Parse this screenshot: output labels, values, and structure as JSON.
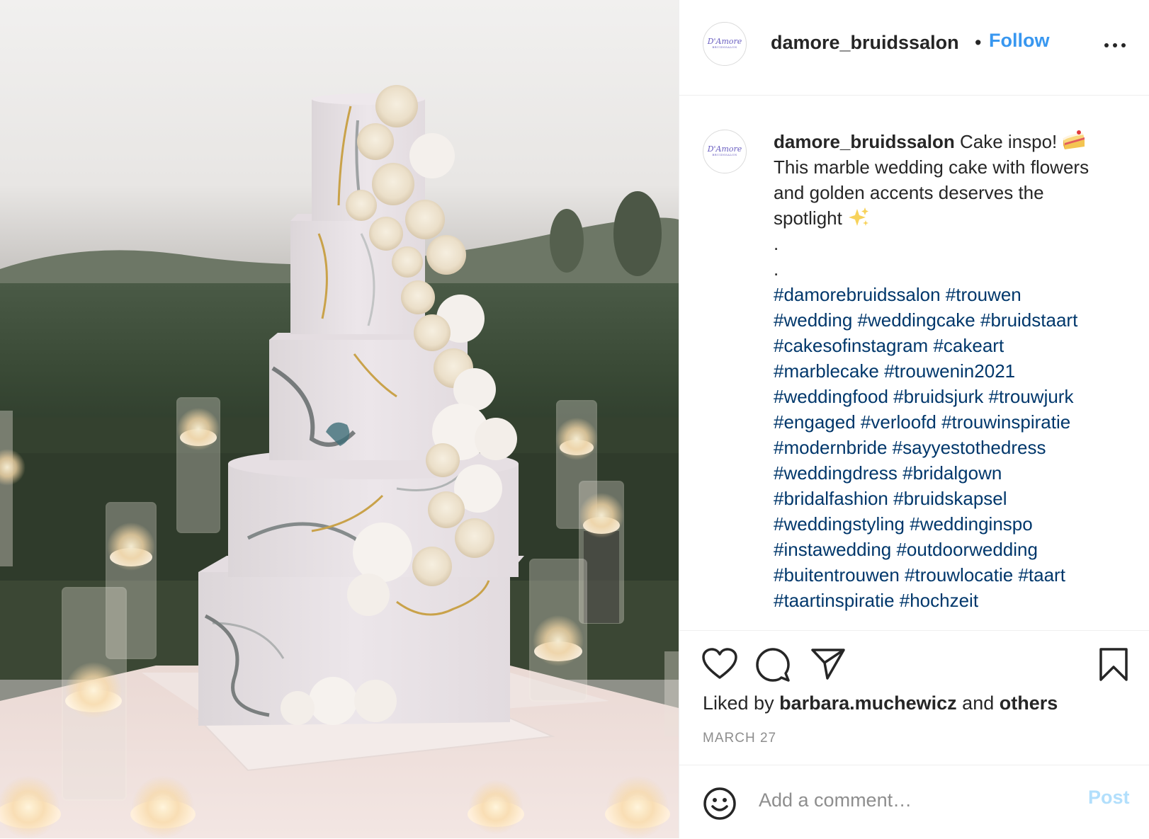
{
  "post": {
    "username": "damore_bruidssalon",
    "avatar_logo_text": "D'Amore",
    "avatar_logo_sub": "BRUIDSSALON",
    "follow_label": "Follow",
    "header_dot": "•",
    "more_icon": "more-options-icon",
    "caption": {
      "username": "damore_bruidssalon",
      "text_line1": " Cake inspo! ",
      "emoji1": "cake-slice-emoji",
      "text_line2": "This marble wedding cake with flowers",
      "text_line3": "and golden accents deserves the",
      "text_line4": "spotlight ",
      "emoji2": "sparkles-emoji",
      "dot1": ".",
      "dot2": ".",
      "hashtag_lines": [
        "#damorebruidssalon #trouwen",
        "#wedding #weddingcake #bruidstaart",
        "#cakesofinstagram #cakeart",
        "#marblecake #trouwenin2021",
        "#weddingfood #bruidsjurk #trouwjurk",
        "#engaged #verloofd #trouwinspiratie",
        "#modernbride #sayyestothedress",
        "#weddingdress #bridalgown",
        "#bridalfashion #bruidskapsel",
        "#weddingstyling #weddinginspo",
        "#instawedding #outdoorwedding",
        "#buitentrouwen #trouwlocatie #taart",
        "#taartinspiratie #hochzeit"
      ]
    },
    "actions": {
      "like_icon": "heart-icon",
      "comment_icon": "comment-icon",
      "share_icon": "share-icon",
      "save_icon": "bookmark-icon"
    },
    "likes": {
      "prefix": "Liked by ",
      "user": "barbara.muchewicz",
      "middle": " and ",
      "others": "others"
    },
    "date": "MARCH 27",
    "comment": {
      "placeholder": "Add a comment…",
      "post_label": "Post",
      "emoji_icon": "smiley-icon"
    },
    "photo": {
      "subject": "marble-wedding-cake-photo"
    }
  }
}
